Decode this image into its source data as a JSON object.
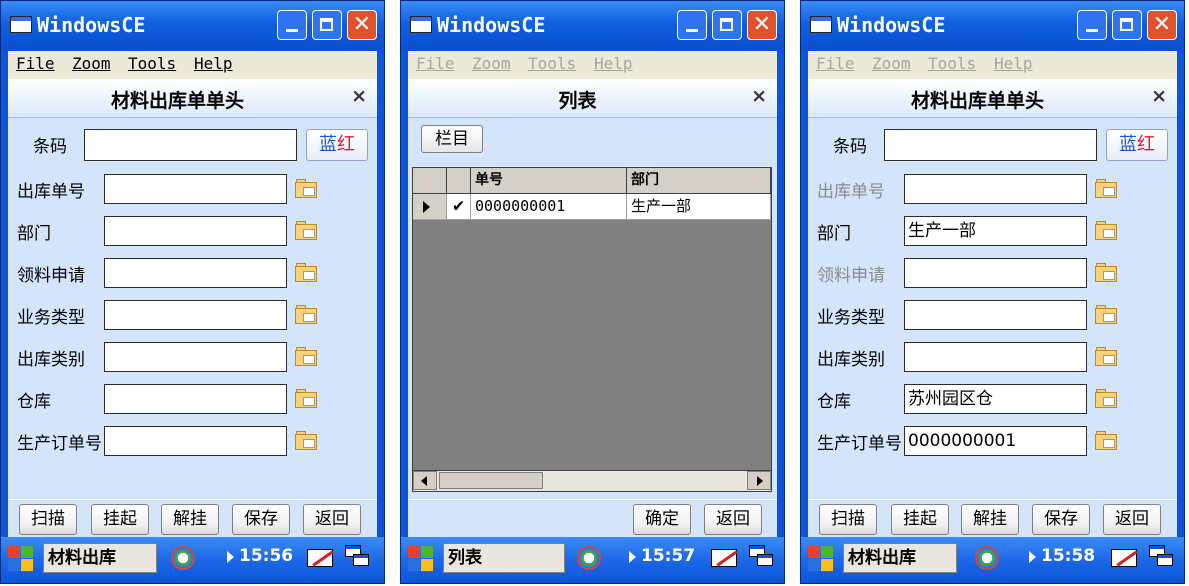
{
  "windows": [
    {
      "title": "WindowsCE",
      "menu": [
        "File",
        "Zoom",
        "Tools",
        "Help"
      ],
      "form_title": "材料出库单单头",
      "close_glyph": "×",
      "barcode_label": "条码",
      "barcode_value": "",
      "color_toggle": {
        "blue": "蓝",
        "red": "红"
      },
      "fields": [
        {
          "label": "出库单号",
          "value": "",
          "disabled": false
        },
        {
          "label": "部门",
          "value": "",
          "disabled": false
        },
        {
          "label": "领料申请",
          "value": "",
          "disabled": false
        },
        {
          "label": "业务类型",
          "value": "",
          "disabled": false
        },
        {
          "label": "出库类别",
          "value": "",
          "disabled": false
        },
        {
          "label": "仓库",
          "value": "",
          "disabled": false
        },
        {
          "label": "生产订单号",
          "value": "",
          "disabled": false
        }
      ],
      "buttons": [
        "扫描",
        "挂起",
        "解挂",
        "保存",
        "返回"
      ],
      "taskbar": {
        "app": "材料出库",
        "time": "15:56"
      }
    },
    {
      "title": "WindowsCE",
      "menu": [
        "File",
        "Zoom",
        "Tools",
        "Help"
      ],
      "form_title": "列表",
      "close_glyph": "×",
      "column_button": "栏目",
      "grid": {
        "columns": [
          "单号",
          "部门"
        ],
        "rows": [
          {
            "order_no": "0000000001",
            "dept": "生产一部",
            "checked": true
          }
        ]
      },
      "buttons": [
        "确定",
        "返回"
      ],
      "taskbar": {
        "app": "列表",
        "time": "15:57"
      }
    },
    {
      "title": "WindowsCE",
      "menu": [
        "File",
        "Zoom",
        "Tools",
        "Help"
      ],
      "form_title": "材料出库单单头",
      "close_glyph": "×",
      "barcode_label": "条码",
      "barcode_value": "",
      "color_toggle": {
        "blue": "蓝",
        "red": "红"
      },
      "fields": [
        {
          "label": "出库单号",
          "value": "",
          "disabled": true
        },
        {
          "label": "部门",
          "value": "生产一部",
          "disabled": false
        },
        {
          "label": "领料申请",
          "value": "",
          "disabled": true
        },
        {
          "label": "业务类型",
          "value": "",
          "disabled": false
        },
        {
          "label": "出库类别",
          "value": "",
          "disabled": false
        },
        {
          "label": "仓库",
          "value": "苏州园区仓",
          "disabled": false
        },
        {
          "label": "生产订单号",
          "value": "0000000001",
          "disabled": false
        }
      ],
      "buttons": [
        "扫描",
        "挂起",
        "解挂",
        "保存",
        "返回"
      ],
      "taskbar": {
        "app": "材料出库",
        "time": "15:58"
      }
    }
  ],
  "colors": {
    "titlebar": "#0b56d8",
    "client": "#d3e4fb",
    "blue_text": "#1f55d6",
    "red_text": "#e02020",
    "disabled_text": "#8c8c8c"
  }
}
